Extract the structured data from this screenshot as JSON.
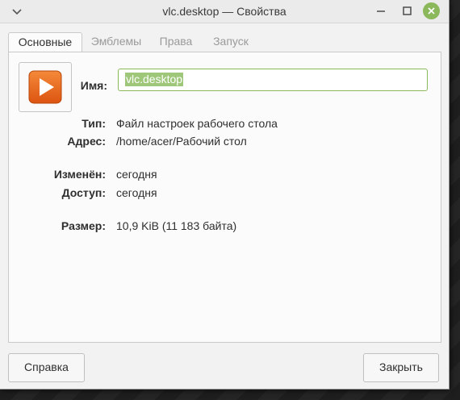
{
  "window": {
    "title": "vlc.desktop — Свойства"
  },
  "tabs": [
    {
      "label": "Основные",
      "active": true
    },
    {
      "label": "Эмблемы",
      "active": false
    },
    {
      "label": "Права",
      "active": false
    },
    {
      "label": "Запуск",
      "active": false
    }
  ],
  "basic": {
    "name_label": "Имя:",
    "name_value": "vlc.desktop",
    "type_label": "Тип:",
    "type_value": "Файл настроек рабочего стола",
    "location_label": "Адрес:",
    "location_value": "/home/acer/Рабочий стол",
    "modified_label": "Изменён:",
    "modified_value": "сегодня",
    "accessed_label": "Доступ:",
    "accessed_value": "сегодня",
    "size_label": "Размер:",
    "size_value": "10,9 KiB (11 183 байта)"
  },
  "buttons": {
    "help": "Справка",
    "close": "Закрыть"
  },
  "colors": {
    "accent": "#8bb85a",
    "selection": "#9ec77a",
    "icon_orange": "#e8651a"
  },
  "icons": {
    "file_icon": "vlc-play-icon"
  }
}
